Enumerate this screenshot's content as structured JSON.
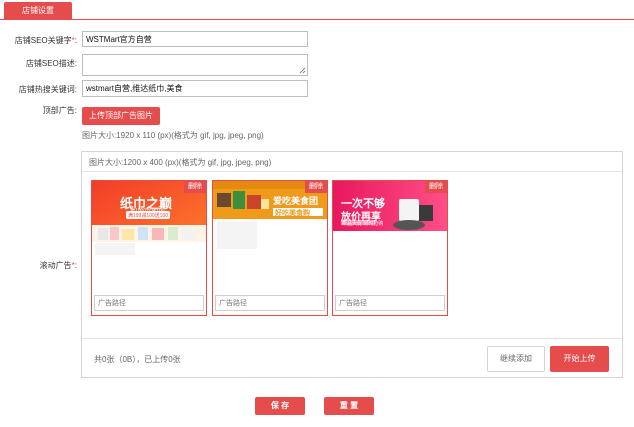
{
  "tab": {
    "label": "店铺设置"
  },
  "form": {
    "seo_keywords": {
      "label": "店铺SEO关键字",
      "required_mark": "*",
      "colon": ":",
      "value": "WSTMart官方自营"
    },
    "seo_description": {
      "label": "店铺SEO描述:",
      "value": ""
    },
    "hot_search": {
      "label": "店铺热搜关键词:",
      "value": "wstmart自营,维达纸巾,美食"
    },
    "top_ad": {
      "label": "顶部广告:",
      "upload_button": "上传顶部广告图片",
      "size_hint": "图片大小:1920 x 110 (px)(格式为 gif, jpg, jpeg, png)"
    },
    "scroll_ad": {
      "label": "滚动广告",
      "required_mark": "*",
      "colon": ":",
      "size_hint": "图片大小:1200 x 400 (px)(格式为 gif, jpg, jpeg, png)",
      "cards": [
        {
          "delete_label": "删除",
          "path_placeholder": "广告路径",
          "banner_text": "纸巾之巅",
          "banner_sub": "满1000元减100",
          "banner_tag": "满199减100送100"
        },
        {
          "delete_label": "删除",
          "path_placeholder": "广告路径",
          "banner_text": "爱吃美食团",
          "banner_sub": "好吃美食购",
          "banner_tag": ""
        },
        {
          "delete_label": "删除",
          "path_placeholder": "广告路径",
          "banner_text": "一次不够",
          "banner_sub": "放价再享",
          "banner_tag": "新品大促 限时抢购"
        }
      ],
      "status": "共0张（0B），已上传0张",
      "continue_button": "继续添加",
      "start_button": "开始上传"
    }
  },
  "actions": {
    "save": "保 存",
    "reset": "重 置"
  },
  "colors": {
    "accent": "#e54d4d",
    "border": "#d4d4d4"
  }
}
